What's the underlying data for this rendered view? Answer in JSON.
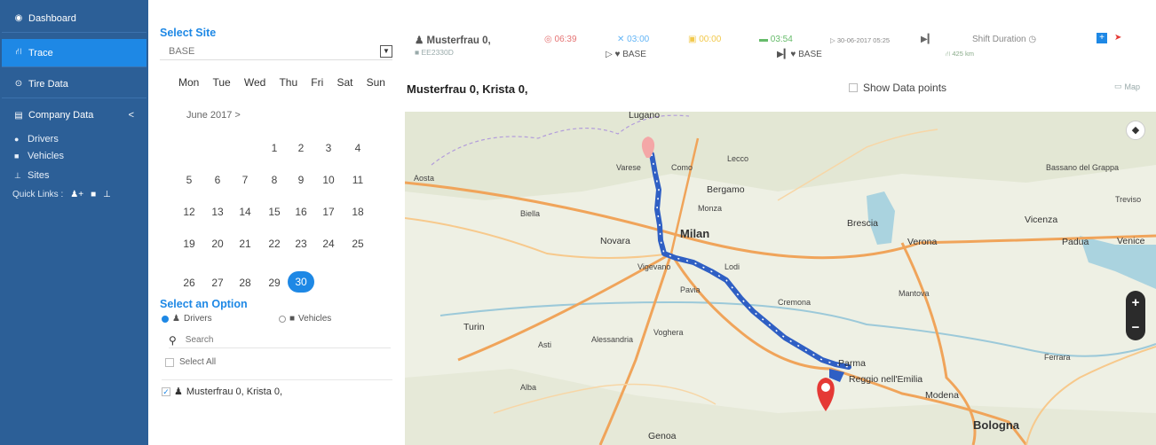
{
  "sidebar": {
    "dashboard": "Dashboard",
    "trace": "Trace",
    "tire_data": "Tire Data",
    "company_data": "Company Data",
    "company_chevron": "<",
    "drivers": "Drivers",
    "vehicles": "Vehicles",
    "sites": "Sites",
    "quick_links": "Quick Links :"
  },
  "site": {
    "title": "Select Site",
    "value": "BASE"
  },
  "calendar": {
    "weekdays": [
      "Mon",
      "Tue",
      "Wed",
      "Thu",
      "Fri",
      "Sat",
      "Sun"
    ],
    "month": "June 2017 >",
    "selected_day": "30",
    "weeks": [
      [
        "",
        "",
        "",
        "1",
        "2",
        "3",
        "4"
      ],
      [
        "5",
        "6",
        "7",
        "8",
        "9",
        "10",
        "11"
      ],
      [
        "12",
        "13",
        "14",
        "15",
        "16",
        "17",
        "18"
      ],
      [
        "19",
        "20",
        "21",
        "22",
        "23",
        "24",
        "25"
      ],
      [
        "26",
        "27",
        "28",
        "29",
        "30",
        "",
        ""
      ]
    ]
  },
  "options": {
    "title": "Select an Option",
    "drivers": "Drivers",
    "vehicles": "Vehicles",
    "search_placeholder": "Search",
    "select_all": "Select All",
    "driver_item": "Musterfrau 0, Krista 0,"
  },
  "info": {
    "name": "Musterfrau 0,",
    "plate": "EE2330D",
    "t1": "06:39",
    "t2": "03:00",
    "t3": "00:00",
    "t4": "03:54",
    "start": "30-06-2017 05:25",
    "shift": "Shift Duration",
    "base1": "BASE",
    "base2": "BASE",
    "km": "425 km"
  },
  "map": {
    "title": "Musterfrau 0, Krista 0,",
    "show_data_points": "Show Data points",
    "map_link": "Map",
    "zoom_in": "+",
    "zoom_out": "−",
    "cities": {
      "lugano": "Lugano",
      "varese": "Varese",
      "como": "Como",
      "lecco": "Lecco",
      "bergamo": "Bergamo",
      "monza": "Monza",
      "milan": "Milan",
      "novara": "Novara",
      "vigevano": "Vigevano",
      "lodi": "Lodi",
      "pavia": "Pavia",
      "brescia": "Brescia",
      "verona": "Verona",
      "vicenza": "Vicenza",
      "padua": "Padua",
      "venice": "Venice",
      "turin": "Turin",
      "asti": "Asti",
      "alessandria": "Alessandria",
      "voghera": "Voghera",
      "cremona": "Cremona",
      "mantova": "Mantova",
      "parma": "Parma",
      "reggio": "Reggio nell'Emilia",
      "modena": "Modena",
      "bologna": "Bologna",
      "ferrara": "Ferrara",
      "genoa": "Genoa",
      "biella": "Biella",
      "aosta": "Aosta",
      "bassano": "Bassano del Grappa",
      "alba": "Alba",
      "treviso": "Treviso"
    }
  },
  "colors": {
    "sidebar_bg": "#2c5f97",
    "accent": "#1e88e5",
    "route": "#2f5fc4",
    "pin": "#e53935"
  }
}
